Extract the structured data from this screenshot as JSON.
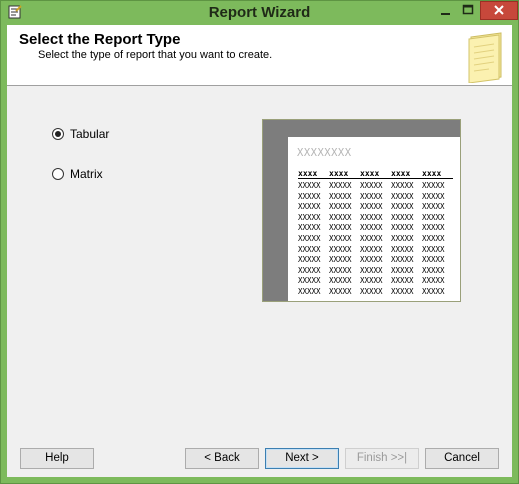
{
  "window": {
    "title": "Report Wizard"
  },
  "header": {
    "title": "Select the Report Type",
    "subtitle": "Select the type of report that you want to create."
  },
  "report_types": [
    {
      "label": "Tabular",
      "selected": true
    },
    {
      "label": "Matrix",
      "selected": false
    }
  ],
  "preview": {
    "title_placeholder": "XXXXXXXX",
    "header_row": [
      "xxxx",
      "xxxx",
      "xxxx",
      "xxxx",
      "xxxx"
    ],
    "data_rows": [
      [
        "XXXXX",
        "XXXXX",
        "XXXXX",
        "XXXXX",
        "XXXXX"
      ],
      [
        "XXXXX",
        "XXXXX",
        "XXXXX",
        "XXXXX",
        "XXXXX"
      ],
      [
        "XXXXX",
        "XXXXX",
        "XXXXX",
        "XXXXX",
        "XXXXX"
      ],
      [
        "XXXXX",
        "XXXXX",
        "XXXXX",
        "XXXXX",
        "XXXXX"
      ],
      [
        "XXXXX",
        "XXXXX",
        "XXXXX",
        "XXXXX",
        "XXXXX"
      ],
      [
        "XXXXX",
        "XXXXX",
        "XXXXX",
        "XXXXX",
        "XXXXX"
      ],
      [
        "XXXXX",
        "XXXXX",
        "XXXXX",
        "XXXXX",
        "XXXXX"
      ],
      [
        "XXXXX",
        "XXXXX",
        "XXXXX",
        "XXXXX",
        "XXXXX"
      ],
      [
        "XXXXX",
        "XXXXX",
        "XXXXX",
        "XXXXX",
        "XXXXX"
      ],
      [
        "XXXXX",
        "XXXXX",
        "XXXXX",
        "XXXXX",
        "XXXXX"
      ],
      [
        "XXXXX",
        "XXXXX",
        "XXXXX",
        "XXXXX",
        "XXXXX"
      ]
    ]
  },
  "buttons": {
    "help": "Help",
    "back": "< Back",
    "next": "Next >",
    "finish": "Finish >>|",
    "cancel": "Cancel"
  },
  "colors": {
    "titlebar": "#7dba5c",
    "close_button": "#c7483b",
    "preview_frame": "#7d7d7d"
  }
}
